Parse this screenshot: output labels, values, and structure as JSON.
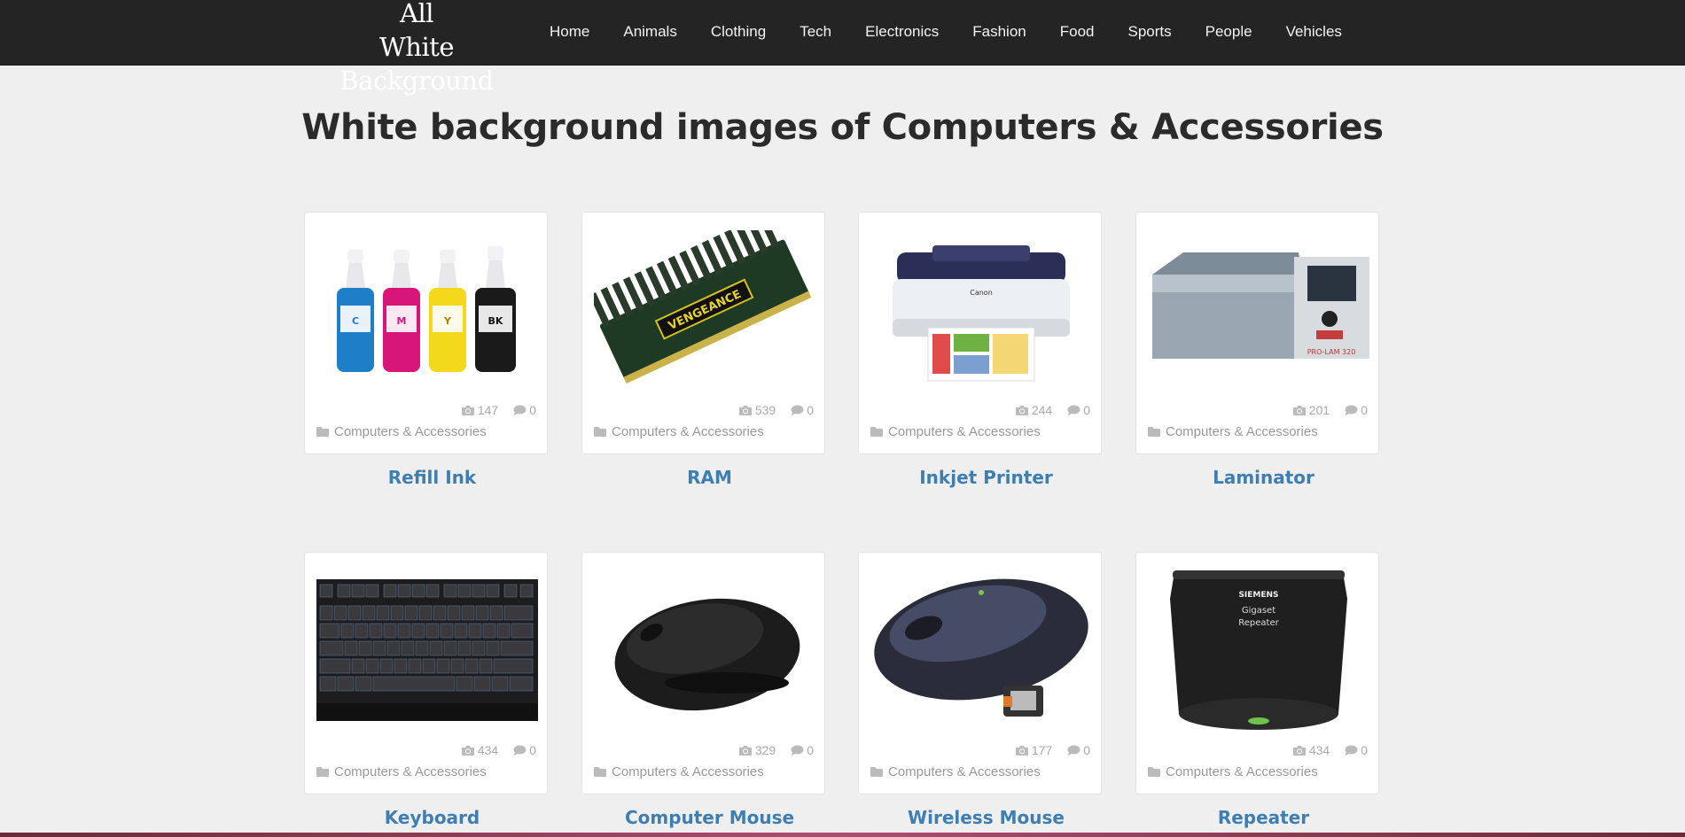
{
  "header": {
    "logo_line1": "All",
    "logo_line2": "White Background",
    "nav": [
      "Home",
      "Animals",
      "Clothing",
      "Tech",
      "Electronics",
      "Fashion",
      "Food",
      "Sports",
      "People",
      "Vehicles"
    ]
  },
  "page_title": "White background images of Computers & Accessories",
  "icons": {
    "views": "camera-icon",
    "comments": "comment-icon",
    "category": "folder-icon"
  },
  "cards": [
    {
      "title": "Refill Ink",
      "views": "147",
      "comments": "0",
      "category": "Computers & Accessories"
    },
    {
      "title": "RAM",
      "views": "539",
      "comments": "0",
      "category": "Computers & Accessories"
    },
    {
      "title": "Inkjet Printer",
      "views": "244",
      "comments": "0",
      "category": "Computers & Accessories"
    },
    {
      "title": "Laminator",
      "views": "201",
      "comments": "0",
      "category": "Computers & Accessories"
    },
    {
      "title": "Keyboard",
      "views": "434",
      "comments": "0",
      "category": "Computers & Accessories"
    },
    {
      "title": "Computer Mouse",
      "views": "329",
      "comments": "0",
      "category": "Computers & Accessories"
    },
    {
      "title": "Wireless Mouse",
      "views": "177",
      "comments": "0",
      "category": "Computers & Accessories"
    },
    {
      "title": "Repeater",
      "views": "434",
      "comments": "0",
      "category": "Computers & Accessories"
    }
  ],
  "product_labels": {
    "ink_bottles": [
      "C",
      "M",
      "Y",
      "BK"
    ],
    "ram_brand": "VENGEANCE",
    "printer_brand": "Canon",
    "laminator_brand": "PRO-LAM 320",
    "repeater_brand": "SIEMENS",
    "repeater_model_1": "Gigaset",
    "repeater_model_2": "Repeater"
  }
}
